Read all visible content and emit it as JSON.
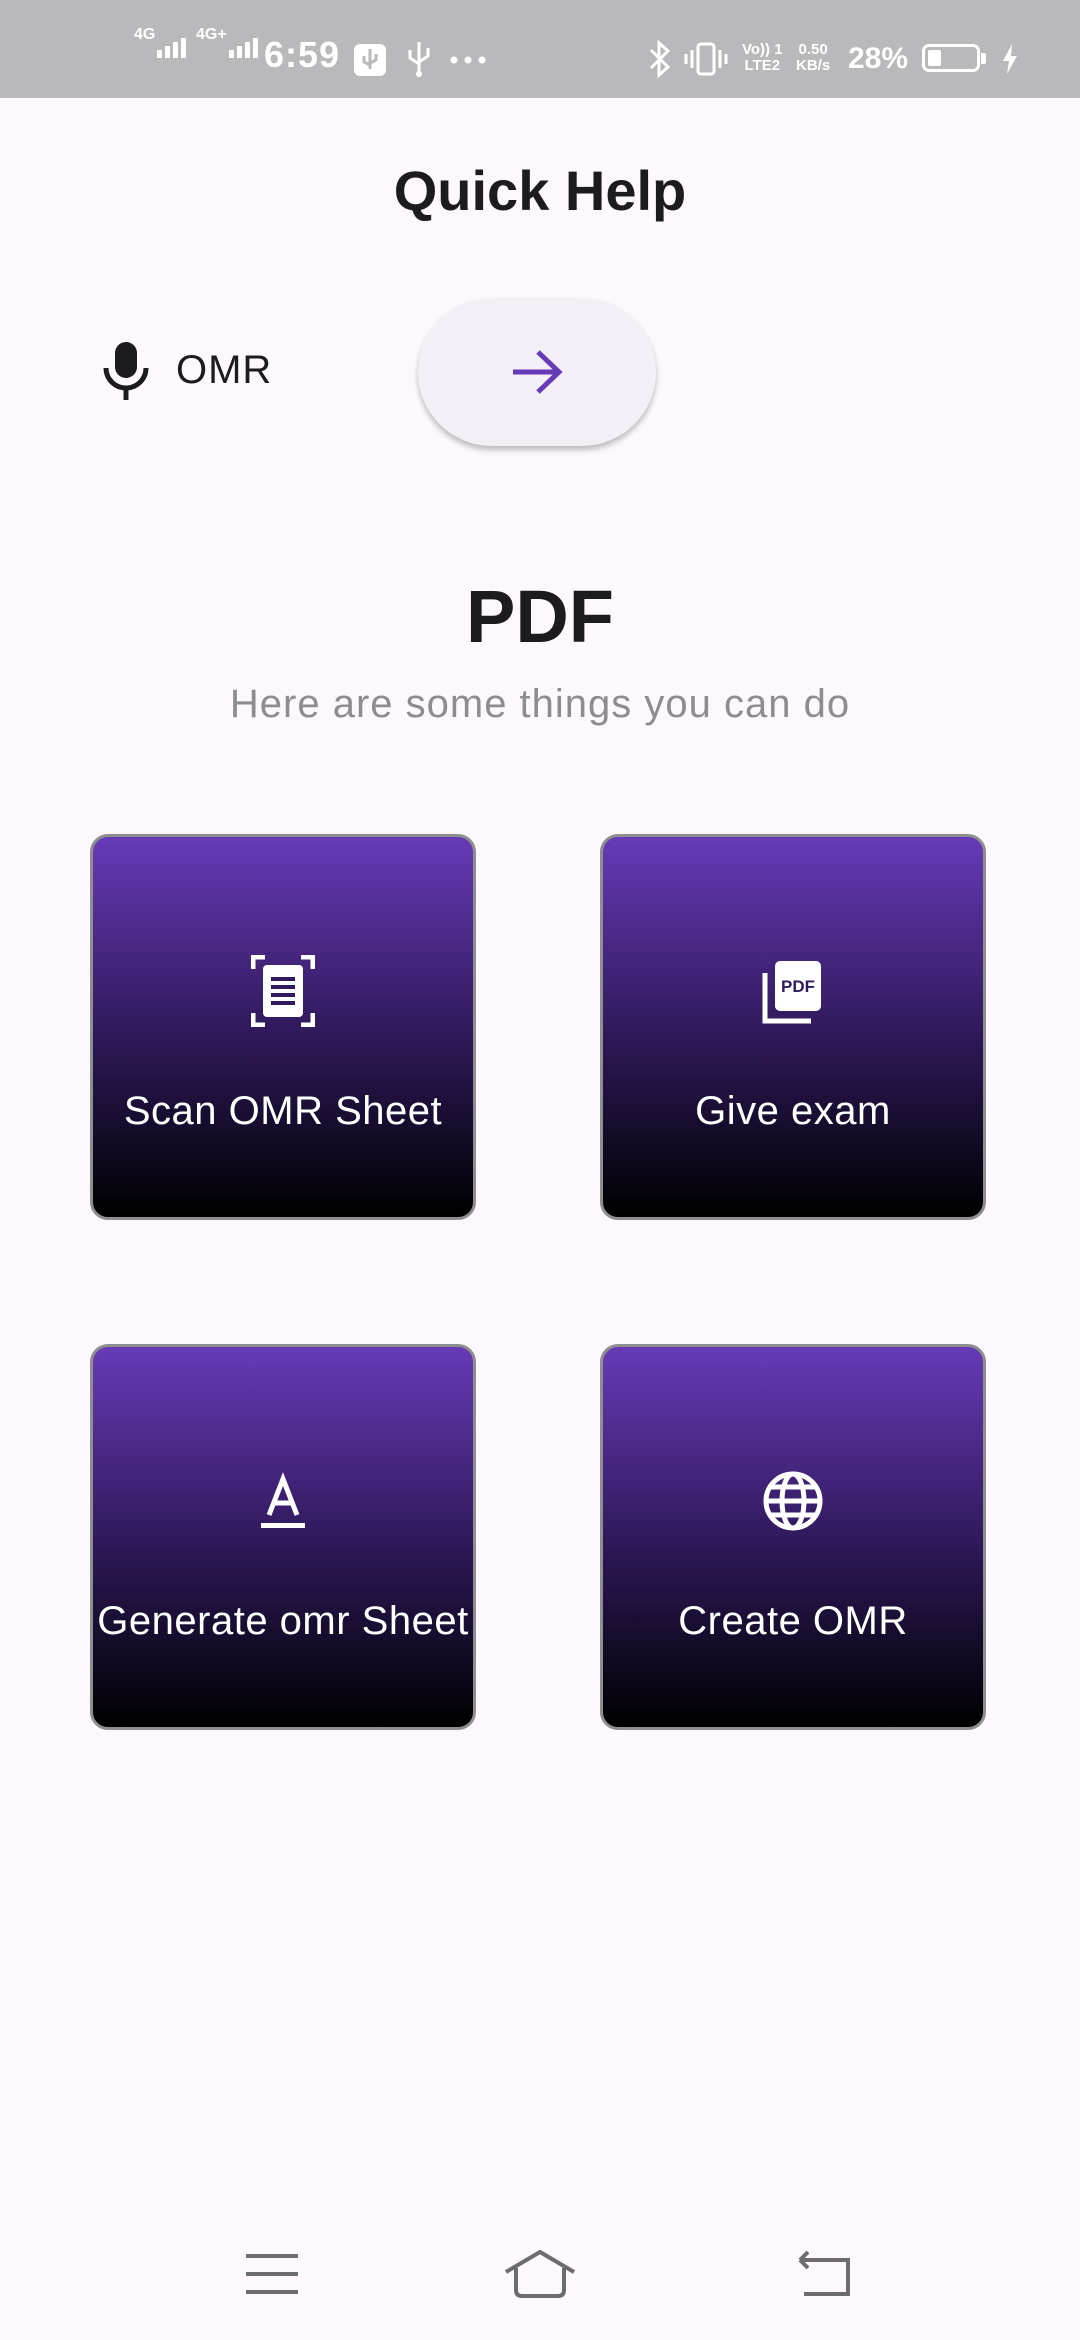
{
  "status_bar": {
    "network_1": "4G",
    "network_2": "4G+",
    "time": "6:59",
    "volte": "Vo)) 1",
    "lte": "LTE2",
    "speed_value": "0.50",
    "speed_unit": "KB/s",
    "battery_percent": "28%",
    "battery_level": 0.28,
    "icons": [
      "usb-debug-icon",
      "usb-icon",
      "more-dots-icon",
      "bluetooth-icon",
      "vibrate-icon",
      "charging-icon"
    ]
  },
  "header": {
    "title": "Quick Help"
  },
  "voice_query": {
    "icon": "mic-icon",
    "text": "OMR",
    "go_icon": "arrow-right-icon"
  },
  "section": {
    "title": "PDF",
    "subtitle": "Here are some things you can do"
  },
  "actions": [
    {
      "label": "Scan OMR Sheet",
      "icon": "document-scanner-icon"
    },
    {
      "label": "Give exam",
      "icon": "pdf-icon"
    },
    {
      "label": "Generate omr Sheet",
      "icon": "text-format-icon"
    },
    {
      "label": "Create OMR",
      "icon": "globe-icon"
    }
  ],
  "colors": {
    "accent": "#673AB7",
    "tile_gradient_top": "#673AB7",
    "tile_gradient_bottom": "#000000",
    "background": "#FDF8FD",
    "subtitle": "#8D8C90"
  },
  "nav_bar": {
    "icons": [
      "menu-icon",
      "home-icon",
      "back-icon"
    ]
  }
}
